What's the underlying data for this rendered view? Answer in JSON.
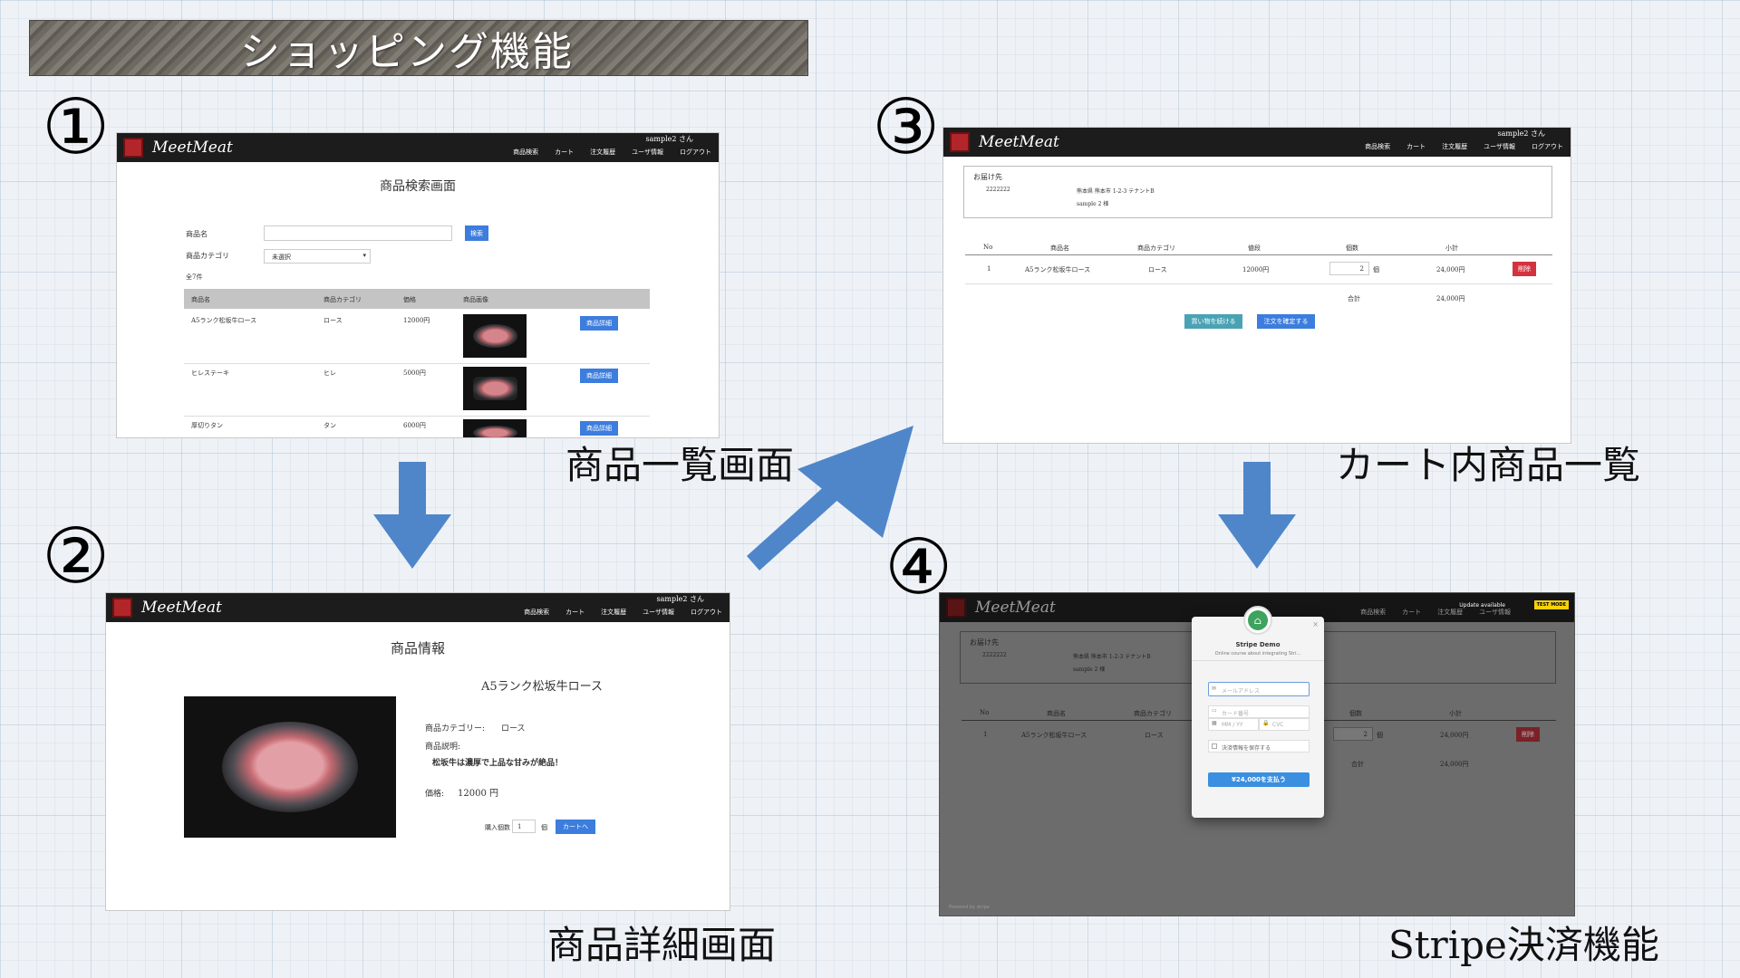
{
  "title": "ショッピング機能",
  "steps": [
    "①",
    "②",
    "③",
    "④"
  ],
  "captions": {
    "step1": "商品一覧画面",
    "step2": "商品詳細画面",
    "step3": "カート内商品一覧",
    "step4": "Stripe決済機能"
  },
  "nav": {
    "logo": "MeetMeat",
    "user": "sample2 さん",
    "links": [
      "商品検索",
      "カート",
      "注文履歴",
      "ユーザ情報",
      "ログアウト"
    ]
  },
  "search_screen": {
    "heading": "商品検索画面",
    "name_label": "商品名",
    "category_label": "商品カテゴリ",
    "category_value": "未選択",
    "search_button": "検索",
    "count": "全7件",
    "columns": [
      "商品名",
      "商品カテゴリ",
      "価格",
      "商品画像"
    ],
    "rows": [
      {
        "name": "A5ランク松坂牛ロース",
        "category": "ロース",
        "price": "12000円",
        "button": "商品詳細"
      },
      {
        "name": "ヒレステーキ",
        "category": "ヒレ",
        "price": "5000円",
        "button": "商品詳細"
      },
      {
        "name": "厚切りタン",
        "category": "タン",
        "price": "6000円",
        "button": "商品詳細"
      }
    ]
  },
  "detail_screen": {
    "heading": "商品情報",
    "product_name": "A5ランク松坂牛ロース",
    "category_label": "商品カテゴリー:",
    "category_value": "ロース",
    "desc_label": "商品説明:",
    "desc_value": "松坂牛は濃厚で上品な甘みが絶品！",
    "price_label": "価格:",
    "price_value": "12000 円",
    "qty_label": "購入個数",
    "qty_value": "1",
    "qty_unit": "個",
    "cart_button": "カートへ"
  },
  "cart_screen": {
    "ship_title": "お届け先",
    "postal": "2222222",
    "address": "熊本県 熊本市 1-2-3 テナントB",
    "recipient": "sample 2 様",
    "columns": [
      "No",
      "商品名",
      "商品カテゴリ",
      "値段",
      "個数",
      "小計"
    ],
    "row": {
      "no": "1",
      "name": "A5ランク松坂牛ロース",
      "category": "ロース",
      "price": "12000円",
      "qty": "2",
      "unit": "個",
      "subtotal": "24,000円",
      "delete": "削除"
    },
    "total_label": "合計",
    "total_value": "24,000円",
    "continue_button": "買い物を続ける",
    "confirm_button": "注文を確定する"
  },
  "stripe_screen": {
    "update_text": "Update available",
    "test_mode": "TEST MODE",
    "modal_title": "Stripe Demo",
    "modal_subtitle": "Online course about integrating Stri...",
    "email_placeholder": "メールアドレス",
    "card_placeholder": "カード番号",
    "exp_placeholder": "MM / YY",
    "cvc_placeholder": "CVC",
    "remember_label": "決済情報を保存する",
    "pay_button": "¥24,000を支払う",
    "powered": "Powered by stripe"
  }
}
